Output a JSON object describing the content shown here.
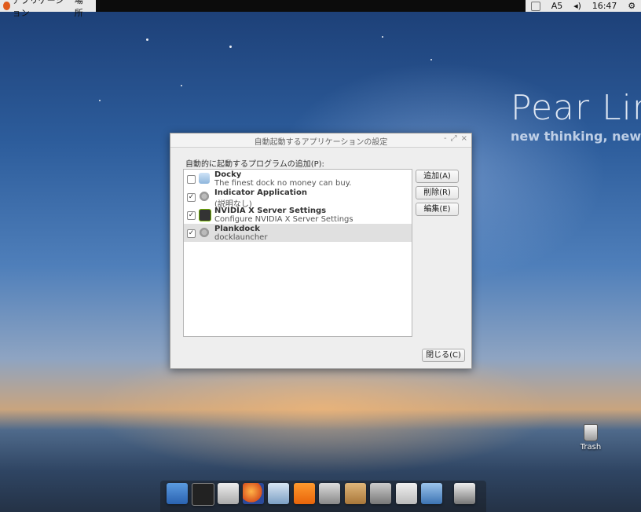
{
  "top_panel": {
    "menu_applications": "アプリケーション",
    "menu_places": "場所",
    "input_method": "A5",
    "clock": "16:47"
  },
  "branding": {
    "title": "Pear Lin",
    "tagline": "new thinking, new p"
  },
  "dialog": {
    "title": "自動起動するアプリケーションの設定",
    "section_label": "自動的に起動するプログラムの追加(P):",
    "items": [
      {
        "name": "Docky",
        "description": "The finest dock no money can buy.",
        "checked": false,
        "icon": "docky-icon"
      },
      {
        "name": "Indicator Application",
        "description": "(説明なし)",
        "checked": true,
        "icon": "gear-icon"
      },
      {
        "name": "NVIDIA X Server Settings",
        "description": "Configure NVIDIA X Server Settings",
        "checked": true,
        "icon": "nvidia-icon"
      },
      {
        "name": "Plankdock",
        "description": "docklauncher",
        "checked": true,
        "icon": "gear-icon"
      }
    ],
    "buttons": {
      "add": "追加(A)",
      "remove": "削除(R)",
      "edit": "編集(E)",
      "close": "閉じる(C)"
    }
  },
  "desktop": {
    "trash_label": "Trash"
  },
  "dock": {
    "items": [
      "anchor-icon",
      "terminal-icon",
      "drive-icon",
      "firefox-icon",
      "mail-icon",
      "vlc-icon",
      "camera-icon",
      "package-icon",
      "tools-icon",
      "settings-icon",
      "display-icon",
      "trash-icon"
    ]
  }
}
